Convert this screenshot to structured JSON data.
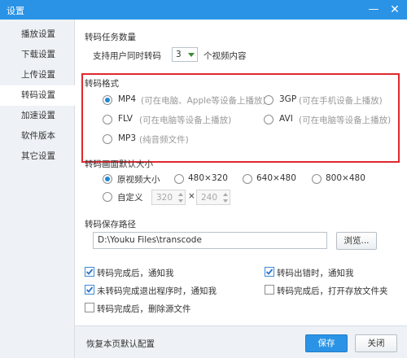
{
  "window": {
    "title": "设置"
  },
  "sidebar": {
    "items": [
      {
        "label": "播放设置"
      },
      {
        "label": "下载设置"
      },
      {
        "label": "上传设置"
      },
      {
        "label": "转码设置"
      },
      {
        "label": "加速设置"
      },
      {
        "label": "软件版本"
      },
      {
        "label": "其它设置"
      }
    ],
    "active_index": 3
  },
  "task_count": {
    "heading": "转码任务数量",
    "prefix": "支持用户同时转码",
    "selected": "3",
    "suffix": "个视频内容"
  },
  "format": {
    "heading": "转码格式",
    "options": [
      {
        "name": "MP4",
        "desc": "(可在电脑、Apple等设备上播放)",
        "selected": true
      },
      {
        "name": "3GP",
        "desc": "(可在手机设备上播放)",
        "selected": false
      },
      {
        "name": "FLV",
        "desc": "(可在电脑等设备上播放)",
        "selected": false
      },
      {
        "name": "AVI",
        "desc": "(可在电脑等设备上播放)",
        "selected": false
      },
      {
        "name": "MP3",
        "desc": "(纯音频文件)",
        "selected": false
      }
    ]
  },
  "size": {
    "heading": "转码画面默认大小",
    "options": [
      {
        "label": "原视频大小",
        "selected": true
      },
      {
        "label": "480×320",
        "selected": false
      },
      {
        "label": "640×480",
        "selected": false
      },
      {
        "label": "800×480",
        "selected": false
      }
    ],
    "custom_label": "自定义",
    "custom_width": "320",
    "custom_height": "240",
    "times": "×"
  },
  "path": {
    "heading": "转码保存路径",
    "value": "D:\\Youku Files\\transcode",
    "browse_label": "浏览..."
  },
  "checks": [
    {
      "label": "转码完成后，通知我",
      "checked": true
    },
    {
      "label": "转码出错时，通知我",
      "checked": true
    },
    {
      "label": "未转码完成退出程序时，通知我",
      "checked": true
    },
    {
      "label": "转码完成后，打开存放文件夹",
      "checked": false
    },
    {
      "label": "转码完成后，删除源文件",
      "checked": false
    }
  ],
  "footer": {
    "restore_label": "恢复本页默认配置",
    "save_label": "保存",
    "close_label": "关闭"
  },
  "colors": {
    "accent": "#2a93e6",
    "highlight_box": "#e0282e"
  }
}
